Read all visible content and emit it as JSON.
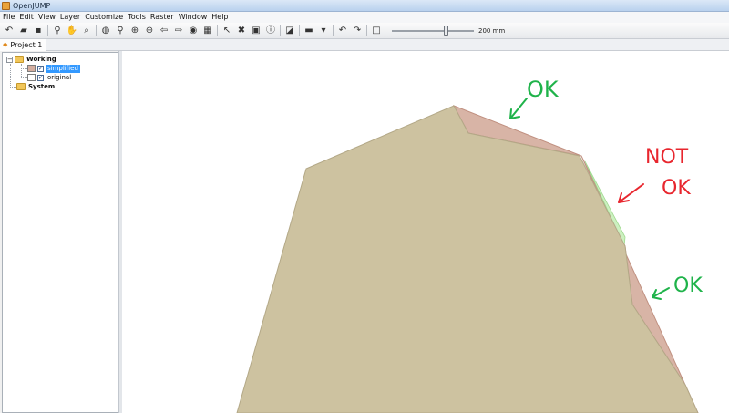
{
  "window": {
    "title": "OpenJUMP"
  },
  "menu": [
    "File",
    "Edit",
    "View",
    "Layer",
    "Customize",
    "Tools",
    "Raster",
    "Window",
    "Help"
  ],
  "toolbar": {
    "icons": [
      {
        "name": "undo-icon",
        "glyph": "↶"
      },
      {
        "name": "open-project-icon",
        "glyph": "▰"
      },
      {
        "name": "save-project-icon",
        "glyph": "▪"
      },
      {
        "sep": true
      },
      {
        "name": "zoom-tool-icon",
        "glyph": "⚲"
      },
      {
        "name": "pan-tool-icon",
        "glyph": "✋"
      },
      {
        "name": "zoom-box-icon",
        "glyph": "⌕"
      },
      {
        "sep": true
      },
      {
        "name": "zoom-full-extent-icon",
        "glyph": "◍"
      },
      {
        "name": "zoom-selected-icon",
        "glyph": "⚲"
      },
      {
        "name": "zoom-in-icon",
        "glyph": "⊕"
      },
      {
        "name": "zoom-out-icon",
        "glyph": "⊖"
      },
      {
        "name": "zoom-previous-icon",
        "glyph": "⇦"
      },
      {
        "name": "zoom-next-icon",
        "glyph": "⇨"
      },
      {
        "name": "zoom-to-fence-icon",
        "glyph": "◉"
      },
      {
        "name": "grid-icon",
        "glyph": "▦"
      },
      {
        "sep": true
      },
      {
        "name": "select-tool-icon",
        "glyph": "↖"
      },
      {
        "name": "delete-selected-icon",
        "glyph": "✖"
      },
      {
        "name": "feature-info-icon",
        "glyph": "▣"
      },
      {
        "name": "info-icon",
        "glyph": "ⓘ"
      },
      {
        "sep": true
      },
      {
        "name": "edit-toolbox-icon",
        "glyph": "◪"
      },
      {
        "sep": true
      },
      {
        "name": "measure-tool-icon",
        "glyph": "▬"
      },
      {
        "name": "dropdown-arrow-icon",
        "glyph": "▾"
      },
      {
        "sep": true
      },
      {
        "name": "undo-edit-icon",
        "glyph": "↶"
      },
      {
        "name": "redo-edit-icon",
        "glyph": "↷"
      },
      {
        "sep": true
      },
      {
        "name": "fence-tool-icon",
        "glyph": "□"
      }
    ],
    "zoom_label": "200 mm",
    "zoom_fraction": 0.67
  },
  "project": {
    "tab_label": "Project 1"
  },
  "layer_tree": {
    "categories": [
      {
        "name": "Working",
        "expanded": true,
        "layers": [
          {
            "name": "simplified",
            "checked": true,
            "selected": true,
            "color": "#d4aea0"
          },
          {
            "name": "original",
            "checked": true,
            "selected": false,
            "color": "#ffffff"
          }
        ]
      },
      {
        "name": "System",
        "expanded": false,
        "layers": []
      }
    ]
  },
  "map": {
    "fill_color": "#cdc2a0",
    "excess_fill": "#d8b4a6",
    "excess_stroke": "#c09080",
    "green_sliver": "#ccf0c0",
    "annotations": [
      {
        "text": "OK",
        "color": "#1fb34a"
      },
      {
        "text": "NOT",
        "color": "#e8262e"
      },
      {
        "text": "OK",
        "color": "#e8262e"
      },
      {
        "text": "OK",
        "color": "#1fb34a"
      }
    ]
  }
}
